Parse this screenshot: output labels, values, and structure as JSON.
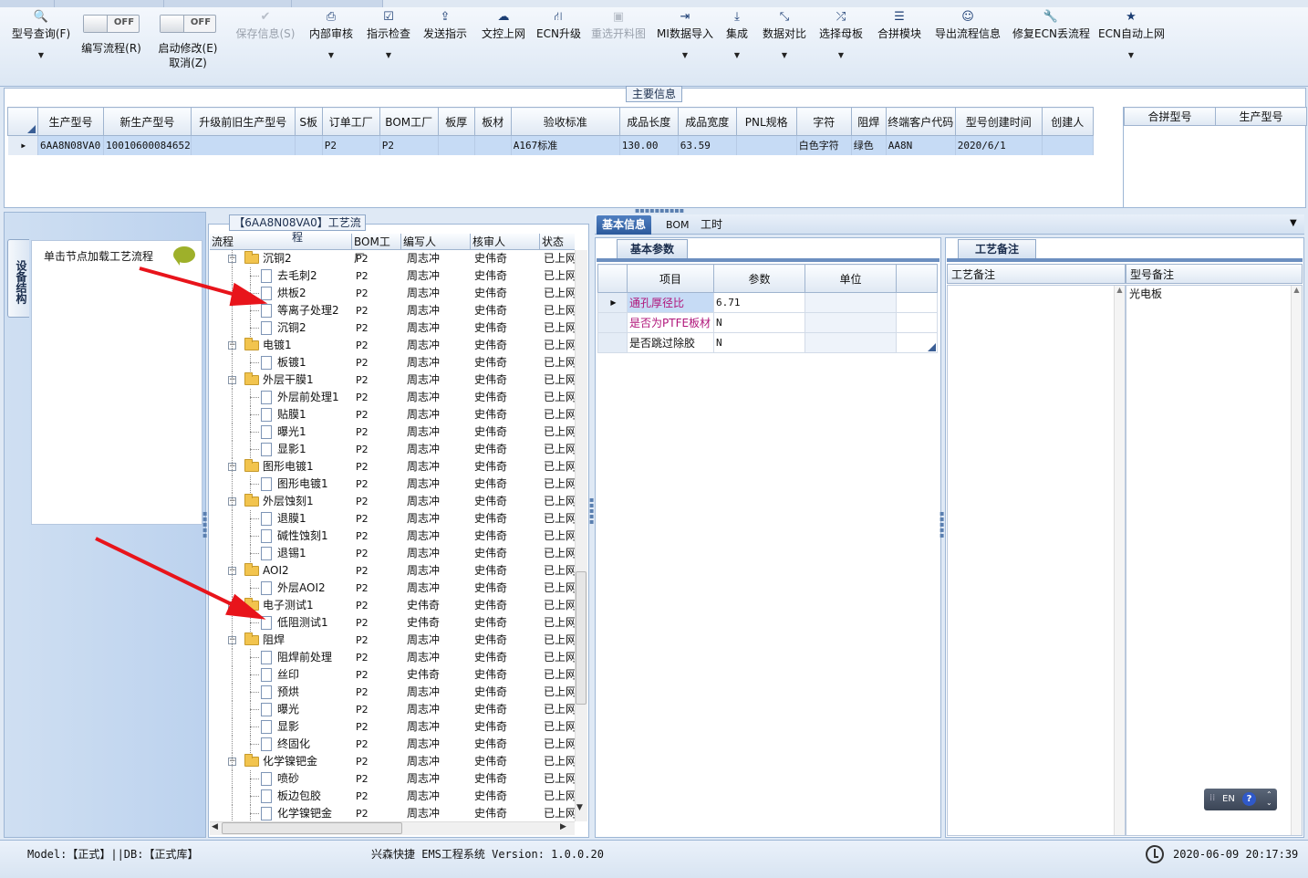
{
  "toolbar": {
    "buttons": [
      {
        "label": "型号查询(F)",
        "icon": "search-icon",
        "glyph": "🔍",
        "dropdown": true,
        "disabled": false
      },
      {
        "label": "编写流程(R)",
        "toggle": "OFF"
      },
      {
        "label": "启动修改(E)",
        "label2": "取消(Z)",
        "toggle": "OFF"
      },
      {
        "label": "保存信息(S)",
        "icon": "check-icon",
        "glyph": "✔",
        "disabled": true
      },
      {
        "label": "内部审核",
        "icon": "print-icon",
        "glyph": "⎙",
        "dropdown": true
      },
      {
        "label": "指示检查",
        "icon": "checkbox-icon",
        "glyph": "☑",
        "dropdown": true
      },
      {
        "label": "发送指示",
        "icon": "upload-icon",
        "glyph": "⇪"
      },
      {
        "label": "文控上网",
        "icon": "cloud-upload-icon",
        "glyph": "☁"
      },
      {
        "label": "ECN升级",
        "icon": "road-icon",
        "glyph": "⛙"
      },
      {
        "label": "重选开料图",
        "icon": "image-icon",
        "glyph": "▣",
        "disabled": true
      },
      {
        "label": "MI数据导入",
        "icon": "login-icon",
        "glyph": "⇥",
        "dropdown": true
      },
      {
        "label": "集成",
        "icon": "download-icon",
        "glyph": "⤓",
        "dropdown": true
      },
      {
        "label": "数据对比",
        "icon": "compress-icon",
        "glyph": "⤡",
        "dropdown": true
      },
      {
        "label": "选择母板",
        "icon": "shuffle-icon",
        "glyph": "⤮",
        "dropdown": true
      },
      {
        "label": "合拼模块",
        "icon": "list-icon",
        "glyph": "☰"
      },
      {
        "label": "导出流程信息",
        "icon": "smile-icon",
        "glyph": "☺"
      },
      {
        "label": "修复ECN丢流程",
        "icon": "wrench-icon",
        "glyph": "🔧"
      },
      {
        "label": "ECN自动上网",
        "icon": "star-icon",
        "glyph": "★",
        "dropdown": true
      }
    ]
  },
  "main_info": {
    "title": "主要信息",
    "columns": [
      "生产型号",
      "新生产型号",
      "升级前旧生产型号",
      "S板",
      "订单工厂",
      "BOM工厂",
      "板厚",
      "板材",
      "验收标准",
      "成品长度",
      "成品宽度",
      "PNL规格",
      "字符",
      "阻焊",
      "终端客户代码",
      "型号创建时间",
      "创建人"
    ],
    "row": [
      "6AA8N08VA0",
      "10010600084652",
      "",
      "",
      "P2",
      "P2",
      "",
      "",
      "A167标准",
      "130.00",
      "63.59",
      "",
      "白色字符",
      "绿色",
      "AA8N",
      "2020/6/1",
      ""
    ],
    "merge_columns": [
      "合拼型号",
      "生产型号"
    ]
  },
  "sidebar": {
    "tab_label": "设备结构",
    "hint": "单击节点加载工艺流程"
  },
  "process": {
    "title": "【6AA8N08VA0】工艺流程",
    "columns": [
      "流程",
      "BOM工厂",
      "编写人",
      "核审人",
      "状态"
    ],
    "rows": [
      {
        "name": "沉铜2",
        "level": 0,
        "bom": "P2",
        "writer": "周志冲",
        "reviewer": "史伟奇",
        "status": "已上网"
      },
      {
        "name": "去毛刺2",
        "level": 1,
        "bom": "P2",
        "writer": "周志冲",
        "reviewer": "史伟奇",
        "status": "已上网"
      },
      {
        "name": "烘板2",
        "level": 1,
        "bom": "P2",
        "writer": "周志冲",
        "reviewer": "史伟奇",
        "status": "已上网"
      },
      {
        "name": "等离子处理2",
        "level": 1,
        "bom": "P2",
        "writer": "周志冲",
        "reviewer": "史伟奇",
        "status": "已上网"
      },
      {
        "name": "沉铜2",
        "level": 1,
        "bom": "P2",
        "writer": "周志冲",
        "reviewer": "史伟奇",
        "status": "已上网"
      },
      {
        "name": "电镀1",
        "level": 0,
        "bom": "P2",
        "writer": "周志冲",
        "reviewer": "史伟奇",
        "status": "已上网"
      },
      {
        "name": "板镀1",
        "level": 1,
        "bom": "P2",
        "writer": "周志冲",
        "reviewer": "史伟奇",
        "status": "已上网"
      },
      {
        "name": "外层干膜1",
        "level": 0,
        "bom": "P2",
        "writer": "周志冲",
        "reviewer": "史伟奇",
        "status": "已上网"
      },
      {
        "name": "外层前处理1",
        "level": 1,
        "bom": "P2",
        "writer": "周志冲",
        "reviewer": "史伟奇",
        "status": "已上网"
      },
      {
        "name": "贴膜1",
        "level": 1,
        "bom": "P2",
        "writer": "周志冲",
        "reviewer": "史伟奇",
        "status": "已上网"
      },
      {
        "name": "曝光1",
        "level": 1,
        "bom": "P2",
        "writer": "周志冲",
        "reviewer": "史伟奇",
        "status": "已上网"
      },
      {
        "name": "显影1",
        "level": 1,
        "bom": "P2",
        "writer": "周志冲",
        "reviewer": "史伟奇",
        "status": "已上网"
      },
      {
        "name": "图形电镀1",
        "level": 0,
        "bom": "P2",
        "writer": "周志冲",
        "reviewer": "史伟奇",
        "status": "已上网"
      },
      {
        "name": "图形电镀1",
        "level": 1,
        "bom": "P2",
        "writer": "周志冲",
        "reviewer": "史伟奇",
        "status": "已上网"
      },
      {
        "name": "外层蚀刻1",
        "level": 0,
        "bom": "P2",
        "writer": "周志冲",
        "reviewer": "史伟奇",
        "status": "已上网"
      },
      {
        "name": "退膜1",
        "level": 1,
        "bom": "P2",
        "writer": "周志冲",
        "reviewer": "史伟奇",
        "status": "已上网"
      },
      {
        "name": "碱性蚀刻1",
        "level": 1,
        "bom": "P2",
        "writer": "周志冲",
        "reviewer": "史伟奇",
        "status": "已上网"
      },
      {
        "name": "退锡1",
        "level": 1,
        "bom": "P2",
        "writer": "周志冲",
        "reviewer": "史伟奇",
        "status": "已上网"
      },
      {
        "name": "AOI2",
        "level": 0,
        "bom": "P2",
        "writer": "周志冲",
        "reviewer": "史伟奇",
        "status": "已上网"
      },
      {
        "name": "外层AOI2",
        "level": 1,
        "bom": "P2",
        "writer": "周志冲",
        "reviewer": "史伟奇",
        "status": "已上网"
      },
      {
        "name": "电子测试1",
        "level": 0,
        "bom": "P2",
        "writer": "史伟奇",
        "reviewer": "史伟奇",
        "status": "已上网"
      },
      {
        "name": "低阻测试1",
        "level": 1,
        "bom": "P2",
        "writer": "史伟奇",
        "reviewer": "史伟奇",
        "status": "已上网"
      },
      {
        "name": "阻焊",
        "level": 0,
        "bom": "P2",
        "writer": "周志冲",
        "reviewer": "史伟奇",
        "status": "已上网"
      },
      {
        "name": "阻焊前处理",
        "level": 1,
        "bom": "P2",
        "writer": "周志冲",
        "reviewer": "史伟奇",
        "status": "已上网"
      },
      {
        "name": "丝印",
        "level": 1,
        "bom": "P2",
        "writer": "史伟奇",
        "reviewer": "史伟奇",
        "status": "已上网"
      },
      {
        "name": "预烘",
        "level": 1,
        "bom": "P2",
        "writer": "周志冲",
        "reviewer": "史伟奇",
        "status": "已上网"
      },
      {
        "name": "曝光",
        "level": 1,
        "bom": "P2",
        "writer": "周志冲",
        "reviewer": "史伟奇",
        "status": "已上网"
      },
      {
        "name": "显影",
        "level": 1,
        "bom": "P2",
        "writer": "周志冲",
        "reviewer": "史伟奇",
        "status": "已上网"
      },
      {
        "name": "终固化",
        "level": 1,
        "bom": "P2",
        "writer": "周志冲",
        "reviewer": "史伟奇",
        "status": "已上网"
      },
      {
        "name": "化学镍钯金",
        "level": 0,
        "bom": "P2",
        "writer": "周志冲",
        "reviewer": "史伟奇",
        "status": "已上网"
      },
      {
        "name": "喷砂",
        "level": 1,
        "bom": "P2",
        "writer": "周志冲",
        "reviewer": "史伟奇",
        "status": "已上网"
      },
      {
        "name": "板边包胶",
        "level": 1,
        "bom": "P2",
        "writer": "周志冲",
        "reviewer": "史伟奇",
        "status": "已上网"
      },
      {
        "name": "化学镍钯金",
        "level": 1,
        "bom": "P2",
        "writer": "周志冲",
        "reviewer": "史伟奇",
        "status": "已上网"
      }
    ]
  },
  "right_tabs": [
    "基本信息",
    "BOM",
    "工时"
  ],
  "basic_params": {
    "tab": "基本参数",
    "columns": [
      "项目",
      "参数",
      "单位"
    ],
    "rows": [
      {
        "item": "通孔厚径比",
        "value": "6.71",
        "unit": "",
        "highlight": true
      },
      {
        "item": "是否为PTFE板材",
        "value": "N",
        "unit": "",
        "highlight": true
      },
      {
        "item": "是否跳过除胶",
        "value": "N",
        "unit": "",
        "highlight": false
      }
    ]
  },
  "remarks": {
    "tab": "工艺备注",
    "col1": "工艺备注",
    "col2": "型号备注",
    "model_remark": "光电板"
  },
  "lang": "EN",
  "status_bar": {
    "left": "Model:【正式】||DB:【正式库】",
    "center": "兴森快捷 EMS工程系统 Version: 1.0.0.20",
    "datetime": "2020-06-09 20:17:39"
  },
  "colors": {
    "selected_row": "#c6dbf5",
    "accent": "#2c5a9c",
    "annotation_arrow": "#e8141b"
  }
}
